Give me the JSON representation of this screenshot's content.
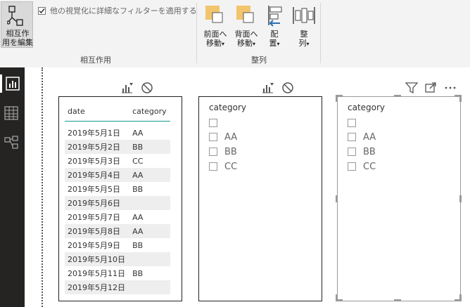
{
  "ribbon": {
    "interaction_button": {
      "line1": "相互作",
      "line2": "用を編集"
    },
    "filter_checkbox": {
      "label": "他の視覚化に詳細なフィルターを適用する",
      "checked": true
    },
    "group_interaction": "相互作用",
    "bring_forward": {
      "line1": "前面へ",
      "line2": "移動"
    },
    "send_backward": {
      "line1": "背面へ",
      "line2": "移動"
    },
    "align": {
      "line1": "配",
      "line2": "置"
    },
    "distribute": {
      "line1": "整",
      "line2": "列"
    },
    "group_arrange": "整列"
  },
  "sidebar": {
    "items": [
      "report-view",
      "data-view",
      "model-view"
    ]
  },
  "table_visual": {
    "headers": [
      "date",
      "category"
    ],
    "rows": [
      [
        "2019年5月1日",
        "AA"
      ],
      [
        "2019年5月2日",
        "BB"
      ],
      [
        "2019年5月3日",
        "CC"
      ],
      [
        "2019年5月4日",
        "AA"
      ],
      [
        "2019年5月5日",
        "BB"
      ],
      [
        "2019年5月6日",
        ""
      ],
      [
        "2019年5月7日",
        "AA"
      ],
      [
        "2019年5月8日",
        "AA"
      ],
      [
        "2019年5月9日",
        "BB"
      ],
      [
        "2019年5月10日",
        ""
      ],
      [
        "2019年5月11日",
        "BB"
      ],
      [
        "2019年5月12日",
        ""
      ]
    ]
  },
  "slicer1": {
    "title": "category",
    "items": [
      "",
      "AA",
      "BB",
      "CC"
    ]
  },
  "slicer2": {
    "title": "category",
    "items": [
      "",
      "AA",
      "BB",
      "CC"
    ]
  },
  "colors": {
    "accent": "#1a9c8c",
    "ribbon_bg": "#f3f3f3",
    "sidebar_bg": "#252423",
    "shape_fill": "#f2c46d"
  }
}
